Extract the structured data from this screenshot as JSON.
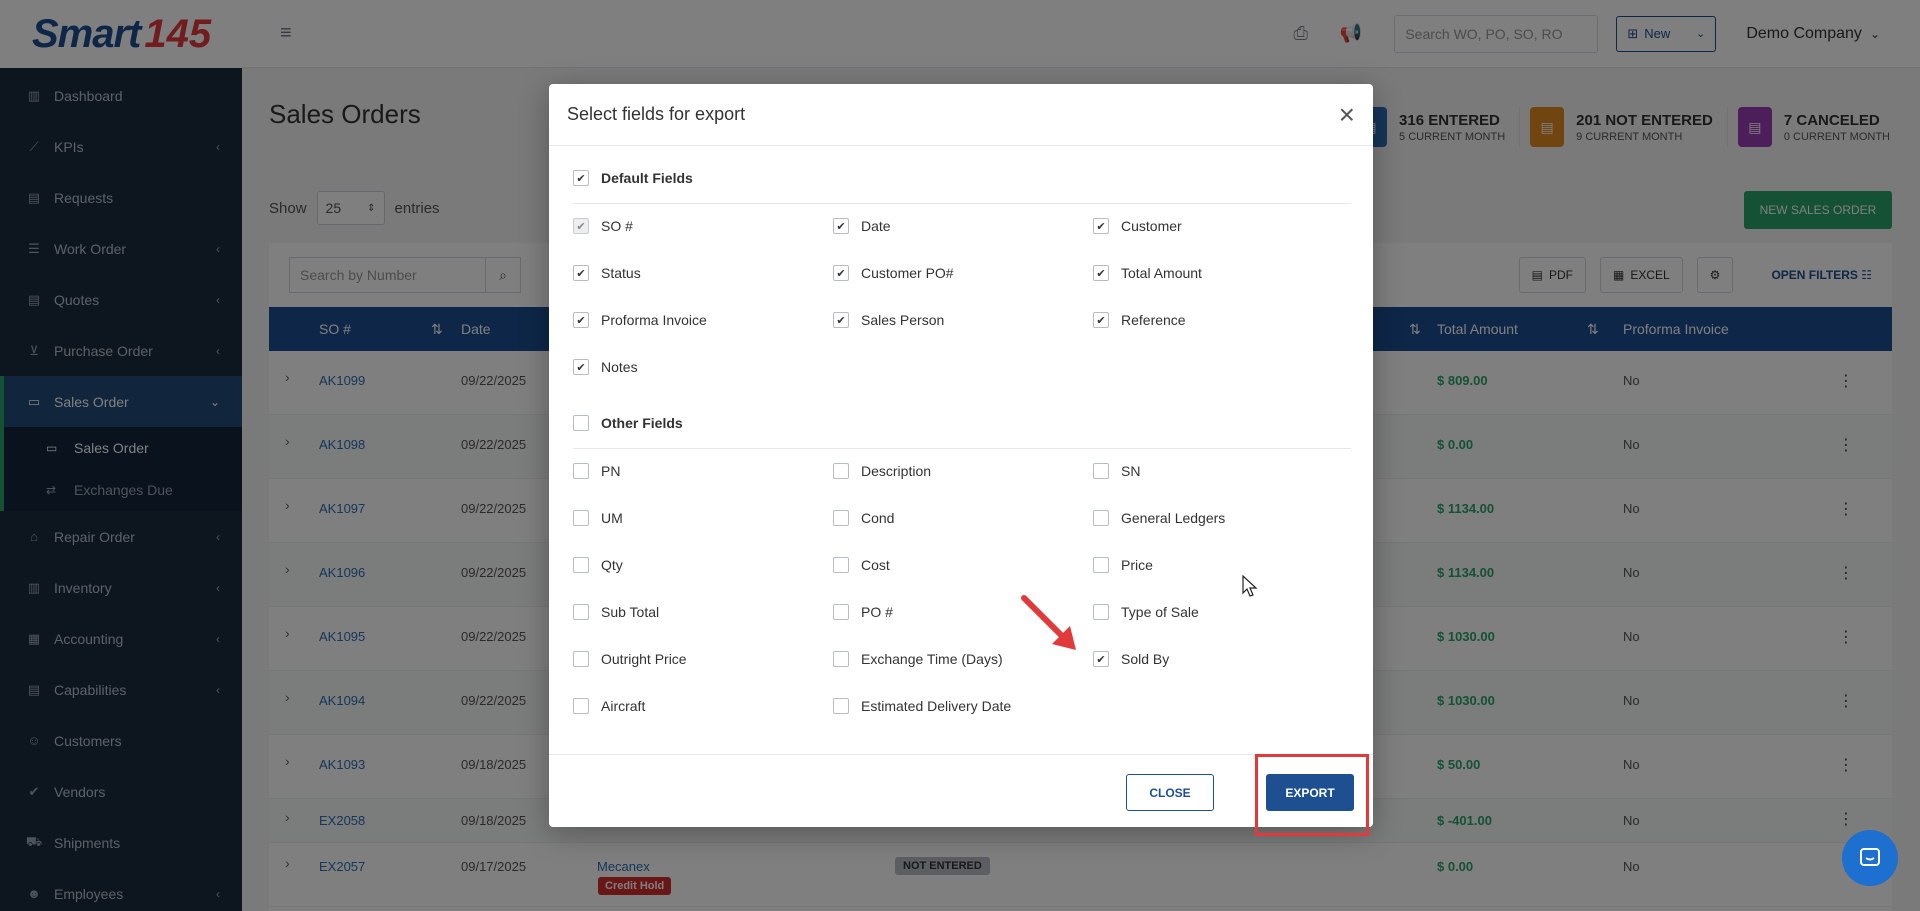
{
  "logo": {
    "text": "Smart",
    "number": "145"
  },
  "sidebar": {
    "items": [
      {
        "label": "Dashboard",
        "icon": "bar-chart-icon"
      },
      {
        "label": "KPIs",
        "icon": "trend-icon"
      },
      {
        "label": "Requests",
        "icon": "document-icon"
      },
      {
        "label": "Work Order",
        "icon": "list-icon"
      },
      {
        "label": "Quotes",
        "icon": "document-icon"
      },
      {
        "label": "Purchase Order",
        "icon": "cart-icon"
      },
      {
        "label": "Sales Order",
        "icon": "card-icon"
      },
      {
        "label": "Repair Order",
        "icon": "bank-icon"
      },
      {
        "label": "Inventory",
        "icon": "bar-chart-icon"
      },
      {
        "label": "Accounting",
        "icon": "calculator-icon"
      },
      {
        "label": "Capabilities",
        "icon": "document-icon"
      },
      {
        "label": "Customers",
        "icon": "user-icon"
      },
      {
        "label": "Vendors",
        "icon": "check-badge-icon"
      },
      {
        "label": "Shipments",
        "icon": "truck-icon"
      },
      {
        "label": "Employees",
        "icon": "users-icon"
      }
    ],
    "sub_items": [
      {
        "label": "Sales Order",
        "icon": "card-icon"
      },
      {
        "label": "Exchanges Due",
        "icon": "exchange-icon"
      }
    ]
  },
  "header": {
    "search_placeholder": "Search WO, PO, SO, RO",
    "new_label": "New",
    "company": "Demo Company"
  },
  "page": {
    "title": "Sales Orders",
    "show_label": "Show",
    "entries_value": "25",
    "entries_label": "entries",
    "new_sales_order": "NEW SALES ORDER",
    "search_placeholder": "Search by Number",
    "pdf_label": "PDF",
    "excel_label": "EXCEL",
    "open_filters": "OPEN FILTERS"
  },
  "stats": [
    {
      "big": "316 ENTERED",
      "small": "5 CURRENT MONTH",
      "color": "#2c6db5"
    },
    {
      "big": "201 NOT ENTERED",
      "small": "9 CURRENT MONTH",
      "color": "#e38a1e"
    },
    {
      "big": "7 CANCELED",
      "small": "0 CURRENT MONTH",
      "color": "#9b3fb5"
    }
  ],
  "table": {
    "headers": {
      "so": "SO #",
      "date": "Date",
      "total": "Total Amount",
      "proforma": "Proforma Invoice"
    },
    "rows": [
      {
        "so": "AK1099",
        "date": "09/22/2025",
        "amount": "$ 809.00",
        "proforma": "No"
      },
      {
        "so": "AK1098",
        "date": "09/22/2025",
        "amount": "$ 0.00",
        "proforma": "No"
      },
      {
        "so": "AK1097",
        "date": "09/22/2025",
        "amount": "$ 1134.00",
        "proforma": "No"
      },
      {
        "so": "AK1096",
        "date": "09/22/2025",
        "amount": "$ 1134.00",
        "proforma": "No"
      },
      {
        "so": "AK1095",
        "date": "09/22/2025",
        "amount": "$ 1030.00",
        "proforma": "No"
      },
      {
        "so": "AK1094",
        "date": "09/22/2025",
        "amount": "$ 1030.00",
        "proforma": "No"
      },
      {
        "so": "AK1093",
        "date": "09/18/2025",
        "amount": "$ 50.00",
        "proforma": "No"
      },
      {
        "so": "EX2058",
        "date": "09/18/2025",
        "amount": "$ -401.00",
        "proforma": "No"
      },
      {
        "so": "EX2057",
        "date": "09/17/2025",
        "amount": "$ 0.00",
        "proforma": "No",
        "customer": "Mecanex",
        "customer_badge": "Credit Hold",
        "status": "NOT ENTERED"
      }
    ]
  },
  "modal": {
    "title": "Select fields for export",
    "default_section": "Default Fields",
    "default_fields": [
      {
        "label": "SO #",
        "checked": true,
        "disabled": true
      },
      {
        "label": "Date",
        "checked": true
      },
      {
        "label": "Customer",
        "checked": true
      },
      {
        "label": "Status",
        "checked": true
      },
      {
        "label": "Customer PO#",
        "checked": true
      },
      {
        "label": "Total Amount",
        "checked": true
      },
      {
        "label": "Proforma Invoice",
        "checked": true
      },
      {
        "label": "Sales Person",
        "checked": true
      },
      {
        "label": "Reference",
        "checked": true
      },
      {
        "label": "Notes",
        "checked": true
      }
    ],
    "other_section": "Other Fields",
    "other_fields": [
      {
        "label": "PN",
        "checked": false
      },
      {
        "label": "Description",
        "checked": false
      },
      {
        "label": "SN",
        "checked": false
      },
      {
        "label": "UM",
        "checked": false
      },
      {
        "label": "Cond",
        "checked": false
      },
      {
        "label": "General Ledgers",
        "checked": false
      },
      {
        "label": "Qty",
        "checked": false
      },
      {
        "label": "Cost",
        "checked": false
      },
      {
        "label": "Price",
        "checked": false
      },
      {
        "label": "Sub Total",
        "checked": false
      },
      {
        "label": "PO #",
        "checked": false
      },
      {
        "label": "Type of Sale",
        "checked": false
      },
      {
        "label": "Outright Price",
        "checked": false
      },
      {
        "label": "Exchange Time (Days)",
        "checked": false
      },
      {
        "label": "Sold By",
        "checked": true
      },
      {
        "label": "Aircraft",
        "checked": false
      },
      {
        "label": "Estimated Delivery Date",
        "checked": false
      }
    ],
    "close_label": "CLOSE",
    "export_label": "EXPORT"
  }
}
